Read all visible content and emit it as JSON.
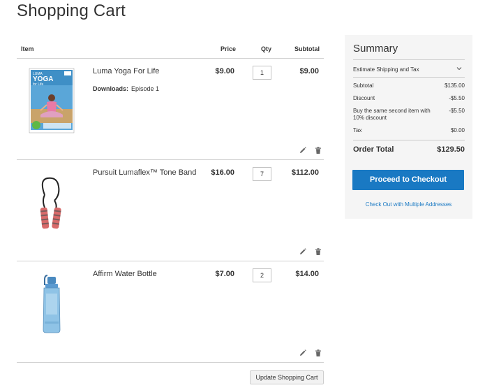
{
  "page": {
    "title": "Shopping Cart"
  },
  "table": {
    "headers": {
      "item": "Item",
      "price": "Price",
      "qty": "Qty",
      "subtotal": "Subtotal"
    },
    "rows": [
      {
        "name": "Luma Yoga For Life",
        "option_label": "Downloads:",
        "option_value": "Episode 1",
        "price": "$9.00",
        "qty": "1",
        "subtotal": "$9.00",
        "thumb_title": "LUMA",
        "thumb_subtitle": "YOGA",
        "thumb_tagline": "for Life"
      },
      {
        "name": "Pursuit Lumaflex™ Tone Band",
        "price": "$16.00",
        "qty": "7",
        "subtotal": "$112.00"
      },
      {
        "name": "Affirm Water Bottle",
        "price": "$7.00",
        "qty": "2",
        "subtotal": "$14.00"
      }
    ]
  },
  "update_button": "Update Shopping Cart",
  "summary": {
    "title": "Summary",
    "estimate_label": "Estimate Shipping and Tax",
    "lines": [
      {
        "label": "Subtotal",
        "value": "$135.00"
      },
      {
        "label": "Discount",
        "value": "-$5.50"
      },
      {
        "label": "Buy the same second item with 10% discount",
        "value": "-$5.50"
      },
      {
        "label": "Tax",
        "value": "$0.00"
      }
    ],
    "order_total_label": "Order Total",
    "order_total_value": "$129.50",
    "checkout_button": "Proceed to Checkout",
    "multi_link": "Check Out with Multiple Addresses"
  },
  "colors": {
    "accent": "#1979c3",
    "summary_bg": "#f5f5f5"
  },
  "icons": {
    "edit": "pencil-icon",
    "delete": "trash-icon",
    "expand": "chevron-down-icon"
  }
}
